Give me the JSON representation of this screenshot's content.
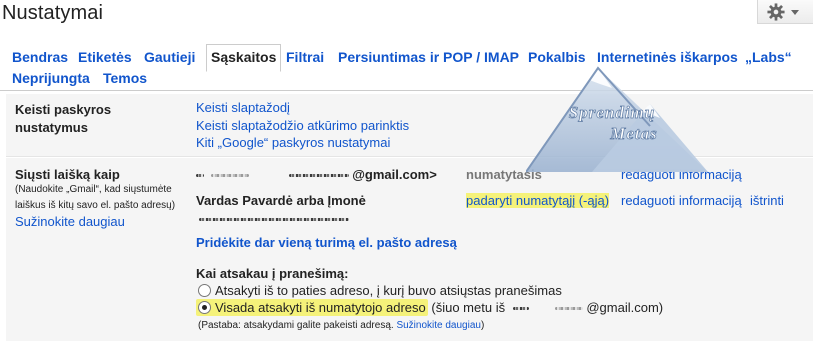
{
  "header": {
    "title": "Nustatymai"
  },
  "tabs": [
    {
      "label": "Bendras",
      "active": false
    },
    {
      "label": "Etiketės",
      "active": false
    },
    {
      "label": "Gautieji",
      "active": false
    },
    {
      "label": "Sąskaitos",
      "active": true
    },
    {
      "label": "Filtrai",
      "active": false
    },
    {
      "label": "Persiuntimas ir POP / IMAP",
      "active": false
    },
    {
      "label": "Pokalbis",
      "active": false
    },
    {
      "label": "Internetinės iškarpos",
      "active": false
    },
    {
      "label": "„Labs“",
      "active": false
    },
    {
      "label": "Neprijungta",
      "active": false
    },
    {
      "label": "Temos",
      "active": false
    }
  ],
  "change_account": {
    "title": "Keisti paskyros nustatymus",
    "links": [
      "Keisti slaptažodį",
      "Keisti slaptažodžio atkūrimo parinktis",
      "Kiti „Google“ paskyros nustatymai"
    ]
  },
  "send_as": {
    "title": "Siųsti laišką kaip",
    "description": "(Naudokite „Gmail“, kad siųstumėte laiškus iš kitų savo el. pašto adresų)",
    "learn_more": "Sužinokite daugiau",
    "primary": {
      "address_suffix": "@gmail.com>",
      "status": "numatytasis",
      "edit_link": "redaguoti informaciją"
    },
    "secondary": {
      "name": "Vardas Pavardė arba Įmonė",
      "make_default_link": "padaryti numatytąjį (-ąją)",
      "edit_link": "redaguoti informaciją",
      "delete_link": "ištrinti"
    },
    "add_address_link": "Pridėkite dar vieną turimą el. pašto adresą",
    "reply_heading": "Kai atsakau į pranešimą:",
    "reply_options": [
      {
        "label": "Atsakyti iš to paties adreso, į kurį buvo atsiųstas pranešimas",
        "selected": false
      },
      {
        "label": "Visada atsakyti iš numatytojo adreso",
        "selected": true
      }
    ],
    "current_prefix": "(šiuo metu iš",
    "current_suffix": "@gmail.com)",
    "note": "(Pastaba: atsakydami galite pakeisti adresą.",
    "note_link": "Sužinokite daugiau"
  },
  "watermark": {
    "line1": "Sprendimų",
    "line2": "Metas"
  },
  "colors": {
    "link": "#1155cc",
    "highlight": "#f5f27a",
    "panel": "#f5f5f5"
  },
  "icons": {
    "settings": "gear-icon"
  }
}
